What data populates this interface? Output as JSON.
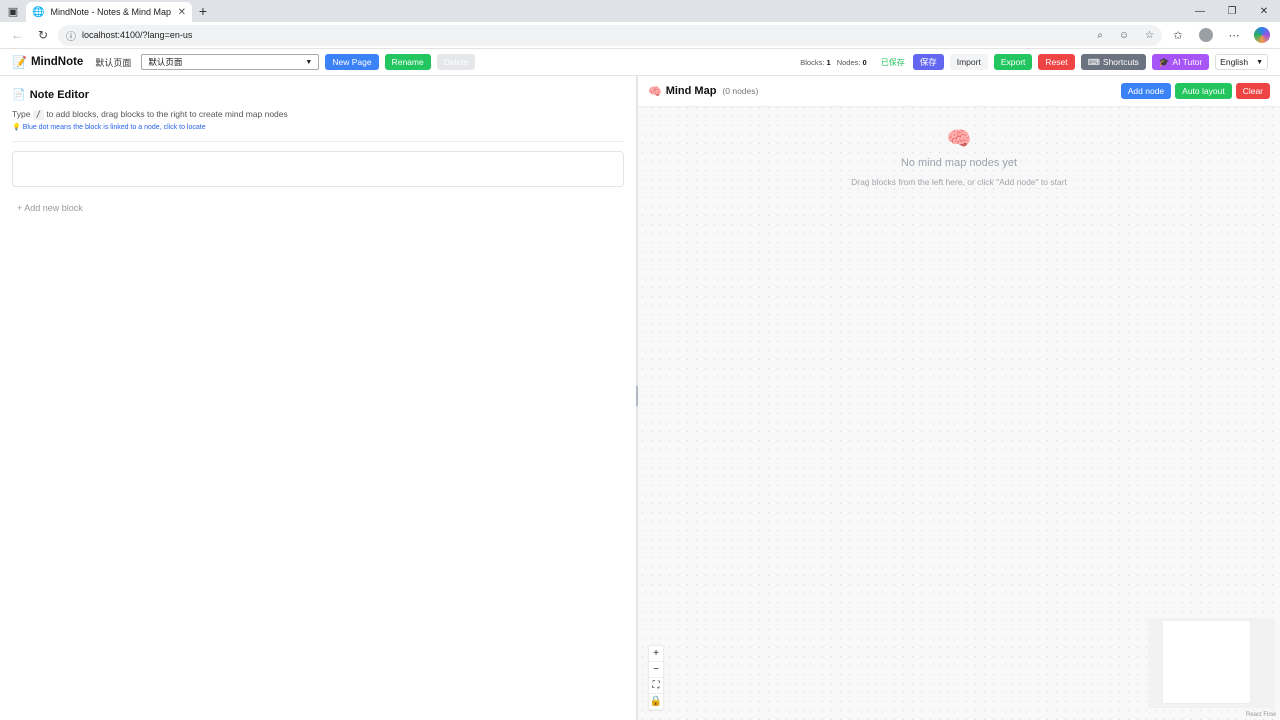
{
  "browser": {
    "tab_title": "MindNote - Notes & Mind Map",
    "url": "localhost:4100/?lang=en-us"
  },
  "toolbar": {
    "brand": "MindNote",
    "current_page": "默认页面",
    "page_select_value": "默认页面",
    "new_page": "New Page",
    "rename": "Rename",
    "delete": "Delete",
    "blocks_label": "Blocks:",
    "blocks_count": "1",
    "nodes_label": "Nodes:",
    "nodes_count": "0",
    "saved_status": "已保存",
    "save": "保存",
    "import": "Import",
    "export": "Export",
    "reset": "Reset",
    "shortcuts": "Shortcuts",
    "ai_tutor": "AI Tutor",
    "language": "English"
  },
  "editor": {
    "title": "Note Editor",
    "hint_prefix": "Type",
    "hint_key": "/",
    "hint_suffix": "to add blocks, drag blocks to the right to create mind map nodes",
    "hint_blue": "Blue dot means the block is linked to a node, click to locate",
    "add_block": "+ Add new block"
  },
  "mindmap": {
    "title": "Mind Map",
    "count": "(0 nodes)",
    "add_node": "Add node",
    "auto_layout": "Auto layout",
    "clear": "Clear",
    "empty_title": "No mind map nodes yet",
    "empty_sub": "Drag blocks from the left here, or click \"Add node\" to start",
    "attribution": "React Flow"
  },
  "colors": {
    "blue": "#3b82f6",
    "green": "#22c55e",
    "red": "#ef4444",
    "purple": "#a855f7"
  }
}
